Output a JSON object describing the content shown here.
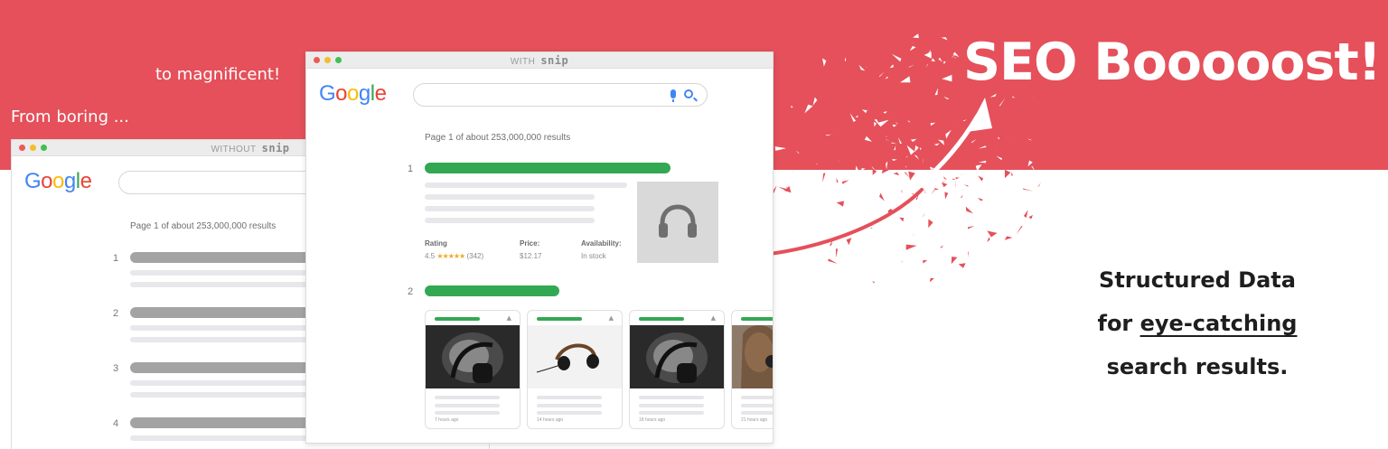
{
  "headline": "SEO Booooost!",
  "captions": {
    "boring": "From boring ...",
    "magnificent": "to magnificent!"
  },
  "tagline": {
    "line1": "Structured Data",
    "line2_prefix": "for ",
    "line2_link": "eye-catching",
    "line3": "search results."
  },
  "colors": {
    "brand_red": "#e5505a",
    "result_green": "#33a853",
    "star_gold": "#f1a823"
  },
  "without_window": {
    "title_prefix": "WITHOUT",
    "title_brand": "snip",
    "logo": "Google",
    "results_count": "Page 1 of about 253,000,000 results",
    "result_numbers": [
      "1",
      "2",
      "3",
      "4"
    ]
  },
  "with_window": {
    "title_prefix": "WITH",
    "title_brand": "snip",
    "logo": "Google",
    "results_count": "Page 1 of about 253,000,000 results",
    "result_numbers": [
      "1",
      "2"
    ],
    "thumbnail_icon": "headphones-icon",
    "meta": {
      "rating_label": "Rating",
      "rating_value": "4.5",
      "rating_stars": "★★★★★",
      "rating_count": "(342)",
      "price_label": "Price:",
      "price_value": "$12.17",
      "availability_label": "Availability:",
      "availability_value": "In stock"
    },
    "cards": [
      {
        "time": "7 hours ago"
      },
      {
        "time": "14 hours ago"
      },
      {
        "time": "18 hours ago"
      },
      {
        "time": "21 hours ago"
      }
    ]
  }
}
